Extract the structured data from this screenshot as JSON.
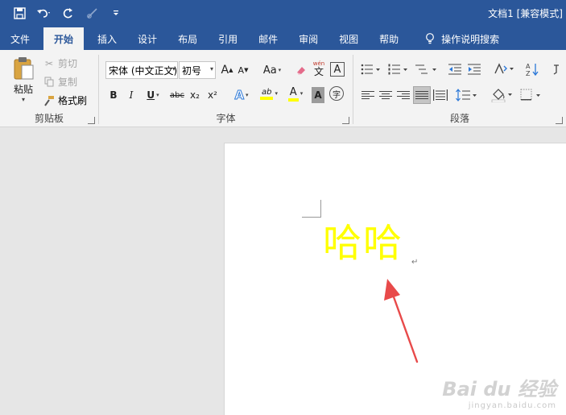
{
  "window": {
    "title": "文档1 [兼容模式]"
  },
  "qat": {
    "save_icon": "save-icon",
    "undo_icon": "undo-icon",
    "redo_icon": "redo-icon",
    "format_painter_icon": "brush-icon",
    "customize_icon": "chevron-down-icon"
  },
  "tabs": [
    {
      "label": "文件"
    },
    {
      "label": "开始",
      "active": true
    },
    {
      "label": "插入"
    },
    {
      "label": "设计"
    },
    {
      "label": "布局"
    },
    {
      "label": "引用"
    },
    {
      "label": "邮件"
    },
    {
      "label": "审阅"
    },
    {
      "label": "视图"
    },
    {
      "label": "帮助"
    },
    {
      "label": "操作说明搜索"
    }
  ],
  "clipboard": {
    "paste_label": "粘贴",
    "cut_label": "剪切",
    "copy_label": "复制",
    "format_painter_label": "格式刷",
    "group_label": "剪贴板"
  },
  "font": {
    "font_name": "宋体 (中文正文)",
    "font_size": "初号",
    "group_label": "字体",
    "buttons": {
      "bold": "B",
      "italic": "I",
      "underline": "U",
      "strike": "abc",
      "subscript": "x₂",
      "superscript": "x²",
      "change_case": "Aa",
      "font_color": "A",
      "phonetic_top": "wén",
      "phonetic_bottom": "文",
      "char_border": "A",
      "char_shading": "A",
      "enclose": "字",
      "grow": "A",
      "shrink": "A",
      "highlight": "ab",
      "text_effect": "A"
    },
    "font_color_hex": "#ffff00",
    "highlight_color_hex": "#ffff00"
  },
  "paragraph": {
    "group_label": "段落",
    "sort_label": "A↓Z"
  },
  "document": {
    "text": "哈哈",
    "text_color": "#ffff00",
    "paragraph_mark": "↵"
  },
  "watermark": {
    "main": "Bai du 经验",
    "sub": "jingyan.baidu.com"
  }
}
